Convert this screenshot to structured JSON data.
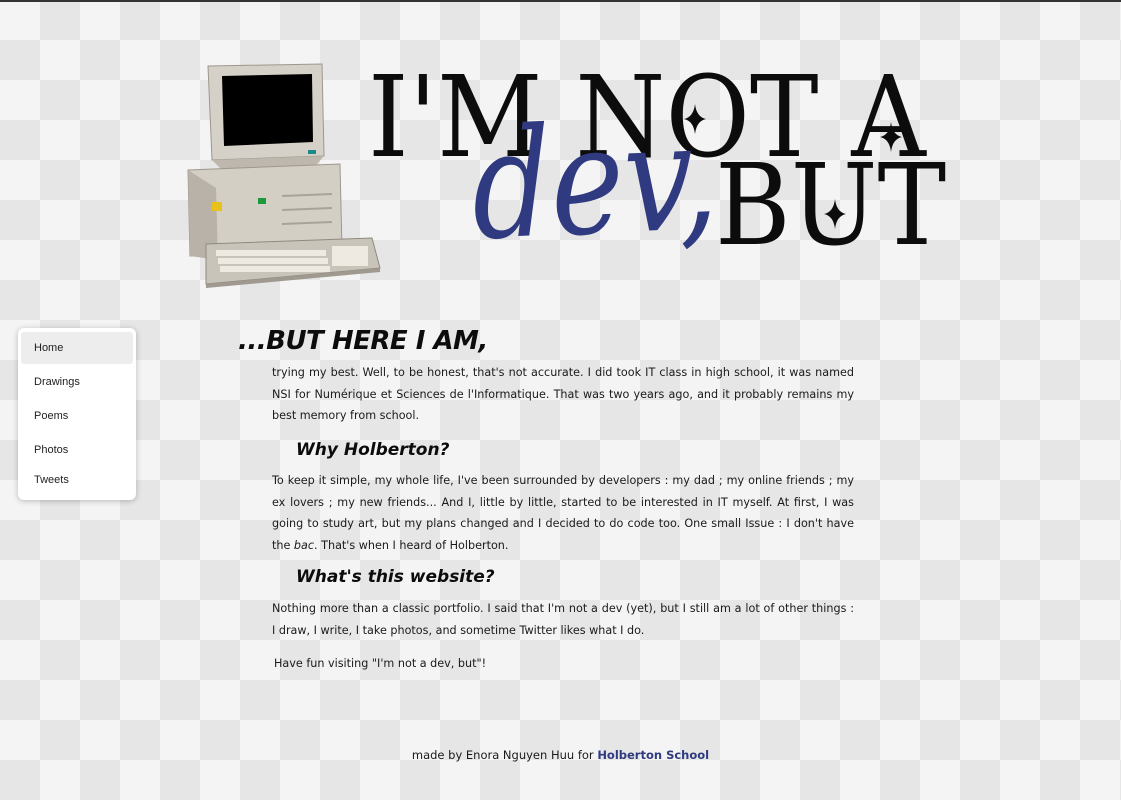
{
  "hero": {
    "line1": "I'M NOT A",
    "dev": "dev,",
    "but": "BUT"
  },
  "nav": {
    "items": [
      "Home",
      "Drawings",
      "Poems",
      "Photos",
      "Tweets"
    ]
  },
  "main": {
    "heading": "...BUT HERE I AM,",
    "intro": "trying my best. Well, to be honest, that's not accurate. I did took IT class in high school, it was named NSI for Numérique et Sciences de l'Informatique. That was two years ago, and it probably remains my best memory from school.",
    "section1_title": "Why Holberton?",
    "section1_text_a": "To keep it simple, my whole life, I've been surrounded by developers : my dad ; my online friends ; my ex lovers ; my new friends... And I, little by little, started to be interested in IT myself. At first, I was going to study art, but my plans changed and I decided to do code too. One small Issue : I don't have the ",
    "section1_text_em": "bac",
    "section1_text_b": ". That's when I heard of Holberton.",
    "section2_title": "What's this website?",
    "section2_text": "Nothing more than a classic portfolio. I said that I'm not a dev (yet), but I still am a lot of other things : I draw, I write, I take photos, and sometime Twitter likes what I do.",
    "closing": "Have fun visiting \"I'm not a dev, but\"!"
  },
  "footer": {
    "text": "made by Enora  Nguyen Huu for ",
    "link": "Holberton School"
  },
  "colors": {
    "accent": "#2f3a80",
    "text": "#0c0c0c",
    "checker_light": "#f4f4f4",
    "checker_dark": "#e6e6e6"
  }
}
